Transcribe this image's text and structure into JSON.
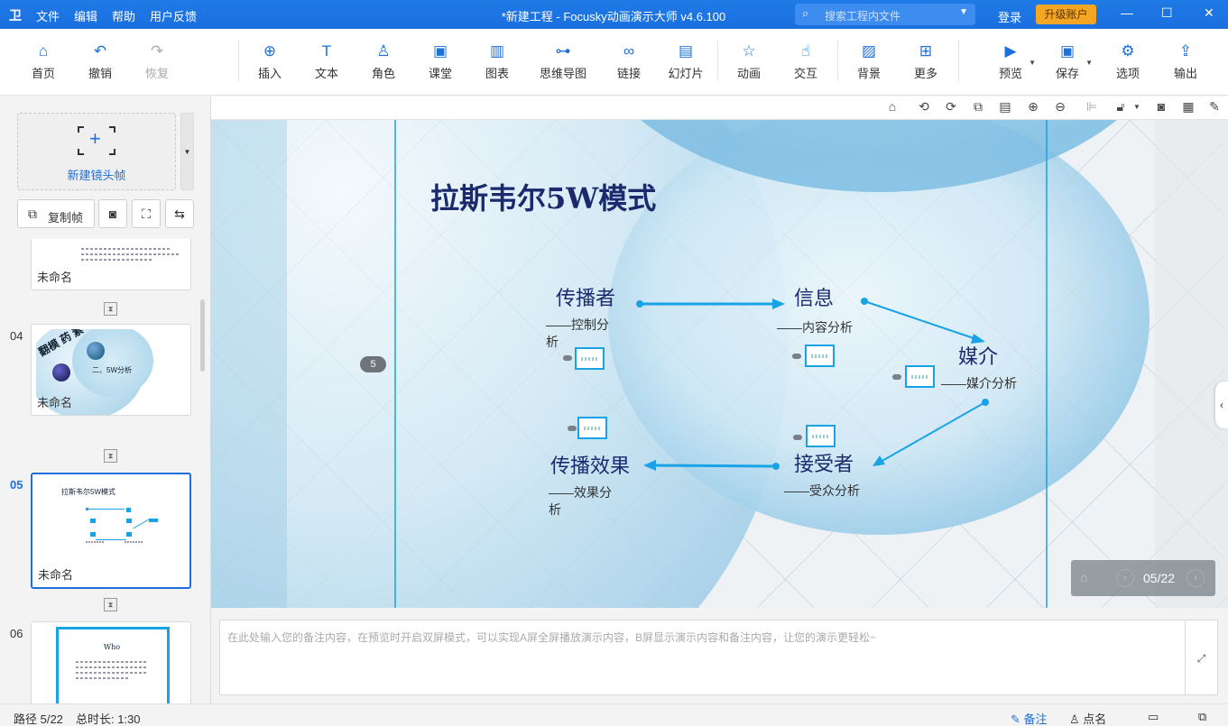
{
  "app": {
    "logo": "卫",
    "menu": [
      "文件",
      "编辑",
      "帮助",
      "用户反馈"
    ],
    "window_title": "*新建工程 - Focusky动画演示大师  v4.6.100",
    "search_placeholder": "搜索工程内文件",
    "login": "登录",
    "upgrade": "升级账户",
    "accent": "#1d70d8"
  },
  "toolbar": {
    "items": [
      {
        "label": "首页",
        "icon": "home-icon"
      },
      {
        "label": "撤销",
        "icon": "undo-icon"
      },
      {
        "label": "恢复",
        "icon": "redo-icon"
      },
      {
        "label": "插入",
        "icon": "plus-circle-icon"
      },
      {
        "label": "文本",
        "icon": "text-icon"
      },
      {
        "label": "角色",
        "icon": "person-icon"
      },
      {
        "label": "课堂",
        "icon": "classroom-icon"
      },
      {
        "label": "图表",
        "icon": "chart-icon"
      },
      {
        "label": "思维导图",
        "icon": "mindmap-icon"
      },
      {
        "label": "链接",
        "icon": "link-icon"
      },
      {
        "label": "幻灯片",
        "icon": "slide-icon"
      },
      {
        "label": "动画",
        "icon": "star-icon"
      },
      {
        "label": "交互",
        "icon": "hand-icon"
      },
      {
        "label": "背景",
        "icon": "background-icon"
      },
      {
        "label": "更多",
        "icon": "grid-icon"
      },
      {
        "label": "预览",
        "icon": "play-icon"
      },
      {
        "label": "保存",
        "icon": "save-icon"
      },
      {
        "label": "选项",
        "icon": "gear-icon"
      },
      {
        "label": "输出",
        "icon": "export-icon"
      }
    ]
  },
  "left_panel": {
    "new_frame": "新建镜头帧",
    "copy_frame": "复制帧",
    "frames": [
      {
        "num": "",
        "name": "未命名",
        "thumb_text": ""
      },
      {
        "num": "04",
        "name": "未命名",
        "thumb_text": "二、5W分析",
        "thumb_words": "翻模 药 素"
      },
      {
        "num": "05",
        "name": "未命名",
        "thumb_text": "拉斯韦尔5W模式"
      },
      {
        "num": "06",
        "name": "",
        "thumb_text": "Who"
      }
    ]
  },
  "slide": {
    "title": "拉斯韦尔5W模式",
    "frame_badge": "5",
    "nodes": {
      "communicator": "传播者",
      "communicator_sub_1": "——控制分",
      "communicator_sub_2": "析",
      "message": "信息",
      "message_sub": "——内容分析",
      "medium": "媒介",
      "medium_sub": "——媒介分析",
      "effect": "传播效果",
      "effect_sub_1": "——效果分",
      "effect_sub_2": "析",
      "receiver": "接受者",
      "receiver_sub": "——受众分析"
    }
  },
  "nav": {
    "page": "05/22"
  },
  "notes": {
    "placeholder": "在此处输入您的备注内容，在预览时开启双屏模式，可以实现A屏全屏播放演示内容，B屏显示演示内容和备注内容，让您的演示更轻松~"
  },
  "status": {
    "path": "路径 5/22",
    "duration": "总时长: 1:30",
    "notes_btn": "备注",
    "rollcall_btn": "点名"
  }
}
